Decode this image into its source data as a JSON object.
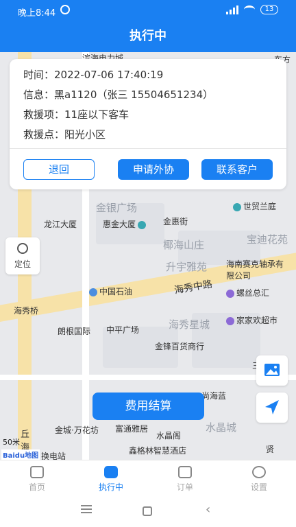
{
  "status_bar": {
    "time": "晚上8:44",
    "battery": "13"
  },
  "header": {
    "title": "执行中"
  },
  "card": {
    "time_label": "时间：",
    "time_value": "2022-07-06 17:40:19",
    "info_label": "信息：",
    "info_value": "黑a1120（张三  15504651234）",
    "item_label": "救援项：",
    "item_value": "11座以下客车",
    "place_label": "救援点：",
    "place_value": "阳光小区",
    "btn_back": "退回",
    "btn_assist": "申请外协",
    "btn_contact": "联系客户"
  },
  "map": {
    "locate_label": "定位",
    "labels": [
      "滨海电力城",
      "东方",
      "金银广场",
      "世贸兰庭",
      "龙江大厦",
      "惠金大厦",
      "金惠街",
      "椰海山庄",
      "宝迪花苑",
      "升宇雅苑",
      "海南赛克轴承有限公司",
      "中国石油",
      "海秀中路",
      "螺丝总汇",
      "海秀桥",
      "海秀星城",
      "家家欢超市",
      "朗根国际",
      "中平广场",
      "金锋百货商行",
      "三友",
      "尚海蓝",
      "金城·万花坊",
      "富通雅居",
      "水晶城",
      "水晶阁",
      "鑫格林智慧酒店",
      "换电站",
      "丘海大道",
      "贤"
    ],
    "scale": "50米",
    "logo_text": "Baidu地图"
  },
  "fee_button": "费用结算",
  "tabs": [
    {
      "label": "首页",
      "icon": "home-icon"
    },
    {
      "label": "执行中",
      "icon": "clock-icon"
    },
    {
      "label": "订单",
      "icon": "order-icon"
    },
    {
      "label": "设置",
      "icon": "gear-icon"
    }
  ],
  "colors": {
    "primary": "#1a80f2"
  }
}
